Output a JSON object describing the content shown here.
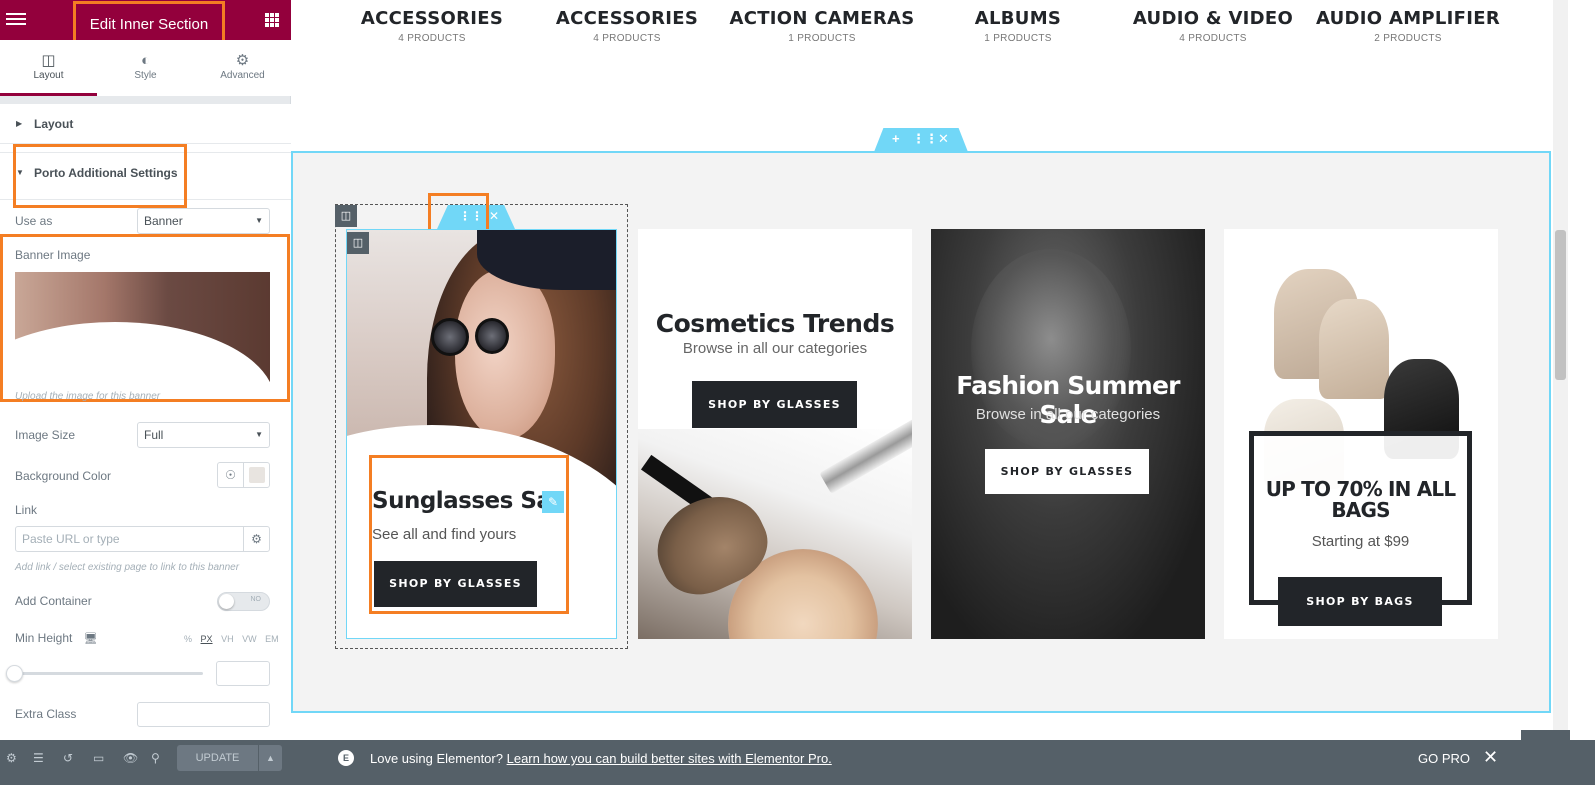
{
  "editor": {
    "header_title": "Edit Inner Section",
    "tabs": [
      {
        "label": "Layout",
        "icon": "layout-icon"
      },
      {
        "label": "Style",
        "icon": "contrast-icon"
      },
      {
        "label": "Advanced",
        "icon": "gear-icon"
      }
    ],
    "sections": {
      "layout": "Layout",
      "porto": "Porto Additional Settings"
    },
    "controls": {
      "use_as_label": "Use as",
      "use_as_value": "Banner",
      "banner_image_label": "Banner Image",
      "banner_image_hint": "Upload the image for this banner",
      "image_size_label": "Image Size",
      "image_size_value": "Full",
      "background_color_label": "Background Color",
      "background_color_value": "#e8e4e0",
      "link_label": "Link",
      "link_placeholder": "Paste URL or type",
      "link_hint": "Add link / select existing page to link to this banner",
      "add_container_label": "Add Container",
      "add_container_state": "NO",
      "min_height_label": "Min Height",
      "units": [
        "%",
        "PX",
        "VH",
        "VW",
        "EM"
      ],
      "active_unit": "PX",
      "extra_class_label": "Extra Class"
    },
    "footer": {
      "update_label": "UPDATE"
    }
  },
  "categories": [
    {
      "name": "ACCESSORIES",
      "count": "4 PRODUCTS"
    },
    {
      "name": "ACCESSORIES",
      "count": "4 PRODUCTS"
    },
    {
      "name": "ACTION CAMERAS",
      "count": "1 PRODUCTS"
    },
    {
      "name": "ALBUMS",
      "count": "1 PRODUCTS"
    },
    {
      "name": "AUDIO & VIDEO",
      "count": "4 PRODUCTS"
    },
    {
      "name": "AUDIO AMPLIFIER",
      "count": "2 PRODUCTS"
    }
  ],
  "banners": [
    {
      "title": "Sunglasses Sa",
      "subtitle": "See all and find yours",
      "button": "SHOP BY GLASSES"
    },
    {
      "title": "Cosmetics Trends",
      "subtitle": "Browse in all our categories",
      "button": "SHOP BY GLASSES"
    },
    {
      "title": "Fashion Summer Sale",
      "subtitle": "Browse in all our categories",
      "button": "SHOP BY GLASSES"
    },
    {
      "title": "UP TO 70% IN ALL BAGS",
      "subtitle": "Starting at $99",
      "button": "SHOP BY BAGS"
    }
  ],
  "notice": {
    "text": "Love using Elementor?",
    "link": "Learn how you can build better sites with Elementor Pro.",
    "go_pro": "GO PRO"
  },
  "colors": {
    "brand": "#93003c",
    "highlight": "#f47e23",
    "handle": "#71d7f7",
    "dark": "#222529"
  }
}
